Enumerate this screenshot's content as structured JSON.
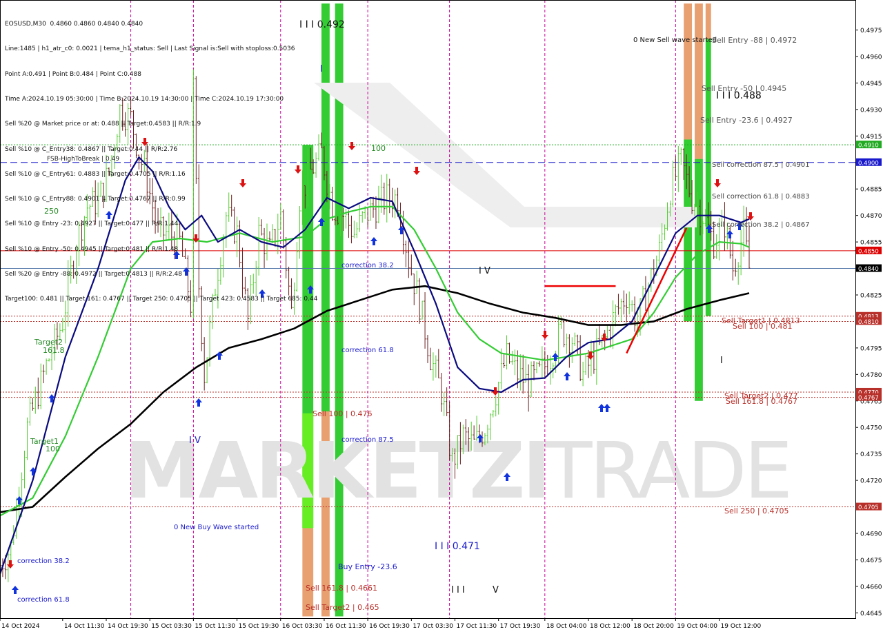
{
  "header": {
    "lines": [
      "EOSUSD,M30  0.4860 0.4860 0.4840 0.4840",
      "Line:1485 | h1_atr_c0: 0.0021 | tema_h1_status: Sell | Last Signal is:Sell with stoploss:0.5036",
      "Point A:0.491 | Point B:0.484 | Point C:0.488",
      "Time A:2024.10.19 05:30:00 | Time B:2024.10.19 14:30:00 | Time C:2024.10.19 17:30:00",
      "Sell %20 @ Market price or at: 0.488 || Target:0.4583 || R/R:1.9",
      "Sell %10 @ C_Entry38: 0.4867 || Target:0.44 || R/R:2.76",
      "Sell %10 @ C_Entry61: 0.4883 || Target:0.4705 || R/R:1.16",
      "Sell %10 @ C_Entry88: 0.4901 || Target:0.4767 || R/R:0.99",
      "Sell %10 @ Entry -23: 0.4927 || Target:0.477 || R/R:1.44",
      "Sell %10 @ Entry -50: 0.4945 || Target:0.481 || R/R:1.48",
      "Sell %20 @ Entry -88: 0.4972 || Target:0.4813 || R/R:2.48",
      "Target100: 0.481 || Target 161: 0.4767 || Target 250: 0.4705 || Target 423: 0.4583 || Target 685: 0.44"
    ]
  },
  "watermark": {
    "bold": "MARKETZI",
    "light": "TRADE"
  },
  "colors": {
    "bull_green": "#33cc33",
    "bright_green": "#66ee22",
    "salmon": "#e8a070",
    "dark_red": "#b8302a",
    "blue_text": "#1a1acc",
    "navy_line": "#0a0a80",
    "ma_green": "#33cc33",
    "ma_black": "#000000",
    "magenta": "#cc0099"
  },
  "chart_data": {
    "type": "candlestick",
    "symbol": "EOSUSD",
    "timeframe": "M30",
    "ohlc_last": {
      "open": 0.486,
      "high": 0.486,
      "low": 0.484,
      "close": 0.484
    },
    "ylim": [
      0.4642,
      0.4992
    ],
    "y_ticks": [
      "0.4975",
      "0.4960",
      "0.4945",
      "0.4930",
      "0.4915",
      "0.4900",
      "0.4885",
      "0.4870",
      "0.4855",
      "0.4840",
      "0.4825",
      "0.4810",
      "0.4795",
      "0.4780",
      "0.4765",
      "0.4750",
      "0.4735",
      "0.4720",
      "0.4705",
      "0.4690",
      "0.4675",
      "0.4660",
      "0.4645"
    ],
    "x_ticks": [
      "14 Oct 2024",
      "14 Oct 11:30",
      "14 Oct 19:30",
      "15 Oct 03:30",
      "15 Oct 11:30",
      "15 Oct 19:30",
      "16 Oct 03:30",
      "16 Oct 11:30",
      "16 Oct 19:30",
      "17 Oct 03:30",
      "17 Oct 11:30",
      "17 Oct 19:30",
      "18 Oct 04:00",
      "18 Oct 12:00",
      "18 Oct 20:00",
      "19 Oct 04:00",
      "19 Oct 12:00"
    ],
    "price_tags": [
      {
        "label": "0.4910",
        "value": 0.491,
        "color": "#22aa22"
      },
      {
        "label": "0.4900",
        "value": 0.49,
        "color": "#1a1acc"
      },
      {
        "label": "0.4850",
        "value": 0.485,
        "color": "#dd0000"
      },
      {
        "label": "0.4840",
        "value": 0.484,
        "color": "#000000"
      },
      {
        "label": "0.4813",
        "value": 0.4813,
        "color": "#b8302a"
      },
      {
        "label": "0.4810",
        "value": 0.481,
        "color": "#b8302a"
      },
      {
        "label": "0.4770",
        "value": 0.477,
        "color": "#b8302a"
      },
      {
        "label": "0.4767",
        "value": 0.4767,
        "color": "#b8302a"
      },
      {
        "label": "0.4705",
        "value": 0.4705,
        "color": "#b8302a"
      }
    ],
    "horizontal_lines": [
      {
        "value": 0.491,
        "color": "#22aa22",
        "dash": "2,2"
      },
      {
        "value": 0.49,
        "color": "#1a1acc",
        "dash": "10,5"
      },
      {
        "value": 0.485,
        "color": "#dd0000",
        "dash": ""
      },
      {
        "value": 0.484,
        "color": "#5577aa",
        "dash": ""
      },
      {
        "value": 0.4813,
        "color": "#b8302a",
        "dash": "2,2"
      },
      {
        "value": 0.481,
        "color": "#b8302a",
        "dash": "2,2"
      },
      {
        "value": 0.477,
        "color": "#b8302a",
        "dash": "2,2"
      },
      {
        "value": 0.4767,
        "color": "#b8302a",
        "dash": "2,2"
      },
      {
        "value": 0.4705,
        "color": "#b8302a",
        "dash": "2,2"
      }
    ],
    "vertical_marker_times": [
      "15 Oct 00:00",
      "15 Oct 11:30",
      "16 Oct 03:30",
      "16 Oct 19:30",
      "17 Oct 10:30",
      "18 Oct 04:00",
      "19 Oct 04:00"
    ],
    "zones": [
      {
        "t0": "16 Oct 07:30",
        "t1": "16 Oct 09:30",
        "from": 0.491,
        "to": 0.4693,
        "color": "bull_green"
      },
      {
        "t0": "16 Oct 07:30",
        "t1": "16 Oct 09:30",
        "from": 0.4693,
        "to": 0.4643,
        "color": "salmon"
      },
      {
        "t0": "16 Oct 11:00",
        "t1": "16 Oct 12:30",
        "from": 0.499,
        "to": 0.4759,
        "color": "bull_green"
      },
      {
        "t0": "16 Oct 11:00",
        "t1": "16 Oct 12:30",
        "from": 0.4759,
        "to": 0.4643,
        "color": "salmon"
      },
      {
        "t0": "16 Oct 13:30",
        "t1": "16 Oct 15:00",
        "from": 0.499,
        "to": 0.4643,
        "color": "bull_green"
      },
      {
        "t0": "19 Oct 05:30",
        "t1": "19 Oct 07:00",
        "from": 0.499,
        "to": 0.4913,
        "color": "salmon"
      },
      {
        "t0": "19 Oct 05:30",
        "t1": "19 Oct 07:00",
        "from": 0.4913,
        "to": 0.481,
        "color": "bull_green"
      },
      {
        "t0": "19 Oct 07:30",
        "t1": "19 Oct 09:00",
        "from": 0.499,
        "to": 0.4902,
        "color": "salmon"
      },
      {
        "t0": "19 Oct 07:30",
        "t1": "19 Oct 09:00",
        "from": 0.4902,
        "to": 0.4765,
        "color": "bull_green"
      },
      {
        "t0": "19 Oct 09:30",
        "t1": "19 Oct 10:30",
        "from": 0.499,
        "to": 0.497,
        "color": "salmon"
      },
      {
        "t0": "19 Oct 09:30",
        "t1": "19 Oct 10:30",
        "from": 0.497,
        "to": 0.4813,
        "color": "bull_green"
      }
    ],
    "annotations": [
      {
        "text": "I I I 0.492",
        "color": "#111111"
      },
      {
        "text": "I",
        "color": "#1a1acc"
      },
      {
        "text": "I I I 0.488",
        "color": "#111111"
      },
      {
        "text": "0 New Sell wave started",
        "color": "#111111"
      },
      {
        "text": "Sell Entry -88 | 0.4972",
        "color": "#555555"
      },
      {
        "text": "Sell Entry -50 | 0.4945",
        "color": "#555555"
      },
      {
        "text": "Sell Entry -23.6 | 0.4927",
        "color": "#555555"
      },
      {
        "text": "Sell correction 87.5 | 0.4901",
        "color": "#444444"
      },
      {
        "text": "Sell correction 61.8 | 0.4883",
        "color": "#444444"
      },
      {
        "text": "Sell correction 38.2 | 0.4867",
        "color": "#444444"
      },
      {
        "text": "Sell Target1 | 0.4813",
        "color": "#b8302a"
      },
      {
        "text": "Sell 100 | 0.481",
        "color": "#b8302a"
      },
      {
        "text": "Sell Target2 | 0.477",
        "color": "#b8302a"
      },
      {
        "text": "Sell 161.8 | 0.4767",
        "color": "#b8302a"
      },
      {
        "text": "Sell  250 | 0.4705",
        "color": "#b8302a"
      },
      {
        "text": "FSB-HighToBreak | 0.49",
        "color": "#222222"
      },
      {
        "text": "250",
        "color": "#228822"
      },
      {
        "text": "Target2",
        "color": "#228822"
      },
      {
        "text": "161.8",
        "color": "#228822"
      },
      {
        "text": "Target1",
        "color": "#228822"
      },
      {
        "text": "100",
        "color": "#228822"
      },
      {
        "text": "100",
        "color": "#228822"
      },
      {
        "text": "correction 38.2",
        "color": "#1a1acc"
      },
      {
        "text": "correction 61.8",
        "color": "#1a1acc"
      },
      {
        "text": "correction 87.5",
        "color": "#1a1acc"
      },
      {
        "text": "Buy Entry -23.6",
        "color": "#1a1acc"
      },
      {
        "text": "Sell 100 | 0.476",
        "color": "#b8302a"
      },
      {
        "text": "Sell 161.8 | 0.4661",
        "color": "#b8302a"
      },
      {
        "text": "Sell Target2 | 0.465",
        "color": "#b8302a"
      },
      {
        "text": "I V",
        "color": "#1a1acc"
      },
      {
        "text": "I V",
        "color": "#111111"
      },
      {
        "text": "I I I 0.471",
        "color": "#1a1acc"
      },
      {
        "text": "I I I",
        "color": "#111111"
      },
      {
        "text": "V",
        "color": "#111111"
      },
      {
        "text": "I",
        "color": "#111111"
      },
      {
        "text": "0 New Buy Wave started",
        "color": "#1a1acc"
      },
      {
        "text": "correction 38.2",
        "color": "#1a1acc"
      },
      {
        "text": "correction 61.8",
        "color": "#1a1acc"
      }
    ],
    "close_path": [
      [
        "14 Oct 00:00",
        0.4672
      ],
      [
        "14 Oct 02:00",
        0.4682
      ],
      [
        "14 Oct 05:00",
        0.475
      ],
      [
        "14 Oct 08:30",
        0.4785
      ],
      [
        "14 Oct 11:30",
        0.481
      ],
      [
        "14 Oct 14:00",
        0.4855
      ],
      [
        "14 Oct 16:00",
        0.4875
      ],
      [
        "14 Oct 18:00",
        0.4878
      ],
      [
        "14 Oct 20:00",
        0.4895
      ],
      [
        "14 Oct 22:00",
        0.493
      ],
      [
        "15 Oct 00:00",
        0.4925
      ],
      [
        "15 Oct 01:30",
        0.4905
      ],
      [
        "15 Oct 03:00",
        0.489
      ],
      [
        "15 Oct 05:00",
        0.486
      ],
      [
        "15 Oct 07:00",
        0.486
      ],
      [
        "15 Oct 09:00",
        0.4855
      ],
      [
        "15 Oct 11:00",
        0.482
      ],
      [
        "15 Oct 11:30",
        0.494
      ],
      [
        "15 Oct 12:30",
        0.483
      ],
      [
        "15 Oct 13:30",
        0.478
      ],
      [
        "15 Oct 15:30",
        0.483
      ],
      [
        "15 Oct 17:30",
        0.487
      ],
      [
        "15 Oct 19:30",
        0.486
      ],
      [
        "15 Oct 21:30",
        0.481
      ],
      [
        "15 Oct 23:30",
        0.486
      ],
      [
        "16 Oct 01:30",
        0.485
      ],
      [
        "16 Oct 03:30",
        0.487
      ],
      [
        "16 Oct 05:30",
        0.4815
      ],
      [
        "16 Oct 07:00",
        0.488
      ],
      [
        "16 Oct 09:00",
        0.4895
      ],
      [
        "16 Oct 11:00",
        0.4905
      ],
      [
        "16 Oct 13:00",
        0.4875
      ],
      [
        "16 Oct 15:00",
        0.487
      ],
      [
        "16 Oct 17:00",
        0.486
      ],
      [
        "16 Oct 19:00",
        0.487
      ],
      [
        "16 Oct 21:00",
        0.4875
      ],
      [
        "16 Oct 23:00",
        0.488
      ],
      [
        "17 Oct 01:00",
        0.488
      ],
      [
        "17 Oct 03:00",
        0.4845
      ],
      [
        "17 Oct 05:00",
        0.482
      ],
      [
        "17 Oct 07:00",
        0.479
      ],
      [
        "17 Oct 09:00",
        0.477
      ],
      [
        "17 Oct 11:00",
        0.473
      ],
      [
        "17 Oct 13:00",
        0.4745
      ],
      [
        "17 Oct 15:00",
        0.474
      ],
      [
        "17 Oct 17:00",
        0.475
      ],
      [
        "17 Oct 19:00",
        0.477
      ],
      [
        "17 Oct 21:00",
        0.479
      ],
      [
        "17 Oct 23:00",
        0.478
      ],
      [
        "18 Oct 01:00",
        0.4775
      ],
      [
        "18 Oct 03:00",
        0.478
      ],
      [
        "18 Oct 05:00",
        0.479
      ],
      [
        "18 Oct 07:00",
        0.4805
      ],
      [
        "18 Oct 09:00",
        0.48
      ],
      [
        "18 Oct 11:00",
        0.478
      ],
      [
        "18 Oct 13:00",
        0.479
      ],
      [
        "18 Oct 15:00",
        0.48
      ],
      [
        "18 Oct 17:00",
        0.4815
      ],
      [
        "18 Oct 19:00",
        0.4825
      ],
      [
        "18 Oct 21:00",
        0.481
      ],
      [
        "18 Oct 23:00",
        0.483
      ],
      [
        "19 Oct 01:00",
        0.485
      ],
      [
        "19 Oct 03:00",
        0.4885
      ],
      [
        "19 Oct 05:00",
        0.49
      ],
      [
        "19 Oct 07:00",
        0.488
      ],
      [
        "19 Oct 09:00",
        0.487
      ],
      [
        "19 Oct 11:00",
        0.4855
      ],
      [
        "19 Oct 13:00",
        0.4865
      ],
      [
        "19 Oct 14:30",
        0.484
      ],
      [
        "19 Oct 16:30",
        0.486
      ],
      [
        "19 Oct 17:30",
        0.484
      ]
    ],
    "navy_ma": [
      [
        "14 Oct 00:00",
        0.4667
      ],
      [
        "14 Oct 06:00",
        0.472
      ],
      [
        "14 Oct 12:00",
        0.479
      ],
      [
        "14 Oct 18:00",
        0.484
      ],
      [
        "14 Oct 23:00",
        0.489
      ],
      [
        "15 Oct 01:30",
        0.4903
      ],
      [
        "15 Oct 04:00",
        0.4895
      ],
      [
        "15 Oct 07:00",
        0.4875
      ],
      [
        "15 Oct 10:00",
        0.4862
      ],
      [
        "15 Oct 13:00",
        0.487
      ],
      [
        "15 Oct 16:00",
        0.4855
      ],
      [
        "15 Oct 20:00",
        0.4862
      ],
      [
        "16 Oct 00:00",
        0.4855
      ],
      [
        "16 Oct 04:00",
        0.4852
      ],
      [
        "16 Oct 08:00",
        0.4862
      ],
      [
        "16 Oct 12:00",
        0.488
      ],
      [
        "16 Oct 16:00",
        0.4874
      ],
      [
        "16 Oct 20:00",
        0.488
      ],
      [
        "17 Oct 00:00",
        0.4878
      ],
      [
        "17 Oct 04:00",
        0.485
      ],
      [
        "17 Oct 08:00",
        0.482
      ],
      [
        "17 Oct 12:00",
        0.4784
      ],
      [
        "17 Oct 16:00",
        0.4772
      ],
      [
        "17 Oct 20:00",
        0.477
      ],
      [
        "18 Oct 00:00",
        0.4777
      ],
      [
        "18 Oct 04:00",
        0.4778
      ],
      [
        "18 Oct 08:00",
        0.479
      ],
      [
        "18 Oct 12:00",
        0.4798
      ],
      [
        "18 Oct 16:00",
        0.48
      ],
      [
        "18 Oct 20:00",
        0.481
      ],
      [
        "19 Oct 00:00",
        0.4835
      ],
      [
        "19 Oct 04:00",
        0.486
      ],
      [
        "19 Oct 08:00",
        0.487
      ],
      [
        "19 Oct 12:00",
        0.487
      ],
      [
        "19 Oct 16:00",
        0.4866
      ],
      [
        "19 Oct 17:30",
        0.4868
      ]
    ],
    "green_ma": [
      [
        "14 Oct 00:00",
        0.47
      ],
      [
        "14 Oct 06:00",
        0.471
      ],
      [
        "14 Oct 12:00",
        0.4745
      ],
      [
        "14 Oct 18:00",
        0.479
      ],
      [
        "15 Oct 00:00",
        0.484
      ],
      [
        "15 Oct 04:00",
        0.4855
      ],
      [
        "15 Oct 09:00",
        0.4857
      ],
      [
        "15 Oct 14:00",
        0.4855
      ],
      [
        "15 Oct 20:00",
        0.486
      ],
      [
        "16 Oct 02:00",
        0.4855
      ],
      [
        "16 Oct 08:00",
        0.4858
      ],
      [
        "16 Oct 12:00",
        0.4868
      ],
      [
        "16 Oct 16:00",
        0.4872
      ],
      [
        "16 Oct 20:00",
        0.4875
      ],
      [
        "17 Oct 00:00",
        0.4875
      ],
      [
        "17 Oct 04:00",
        0.4862
      ],
      [
        "17 Oct 08:00",
        0.484
      ],
      [
        "17 Oct 12:00",
        0.4815
      ],
      [
        "17 Oct 16:00",
        0.48
      ],
      [
        "17 Oct 20:00",
        0.4792
      ],
      [
        "18 Oct 00:00",
        0.479
      ],
      [
        "18 Oct 04:00",
        0.4788
      ],
      [
        "18 Oct 08:00",
        0.479
      ],
      [
        "18 Oct 12:00",
        0.4792
      ],
      [
        "18 Oct 16:00",
        0.4796
      ],
      [
        "18 Oct 20:00",
        0.48
      ],
      [
        "19 Oct 00:00",
        0.4815
      ],
      [
        "19 Oct 04:00",
        0.4835
      ],
      [
        "19 Oct 08:00",
        0.4848
      ],
      [
        "19 Oct 12:00",
        0.4855
      ],
      [
        "19 Oct 16:00",
        0.4854
      ],
      [
        "19 Oct 17:30",
        0.4852
      ]
    ],
    "black_ma": [
      [
        "14 Oct 00:00",
        0.4702
      ],
      [
        "14 Oct 06:00",
        0.4705
      ],
      [
        "14 Oct 12:00",
        0.4722
      ],
      [
        "14 Oct 18:00",
        0.4738
      ],
      [
        "15 Oct 00:00",
        0.4752
      ],
      [
        "15 Oct 06:00",
        0.477
      ],
      [
        "15 Oct 12:00",
        0.4784
      ],
      [
        "15 Oct 18:00",
        0.4795
      ],
      [
        "16 Oct 00:00",
        0.48
      ],
      [
        "16 Oct 06:00",
        0.4806
      ],
      [
        "16 Oct 12:00",
        0.4816
      ],
      [
        "16 Oct 18:00",
        0.4822
      ],
      [
        "17 Oct 00:00",
        0.4828
      ],
      [
        "17 Oct 06:00",
        0.483
      ],
      [
        "17 Oct 12:00",
        0.4826
      ],
      [
        "17 Oct 18:00",
        0.482
      ],
      [
        "18 Oct 00:00",
        0.4815
      ],
      [
        "18 Oct 06:00",
        0.4812
      ],
      [
        "18 Oct 12:00",
        0.4808
      ],
      [
        "18 Oct 18:00",
        0.4808
      ],
      [
        "19 Oct 00:00",
        0.481
      ],
      [
        "19 Oct 06:00",
        0.4817
      ],
      [
        "19 Oct 12:00",
        0.4822
      ],
      [
        "19 Oct 17:30",
        0.4826
      ]
    ],
    "red_trendlines": [
      {
        "from": [
          "18 Oct 04:00",
          0.483
        ],
        "to": [
          "18 Oct 17:00",
          0.483
        ]
      },
      {
        "from": [
          "18 Oct 19:00",
          0.4792
        ],
        "to": [
          "19 Oct 06:00",
          0.4863
        ]
      }
    ]
  }
}
